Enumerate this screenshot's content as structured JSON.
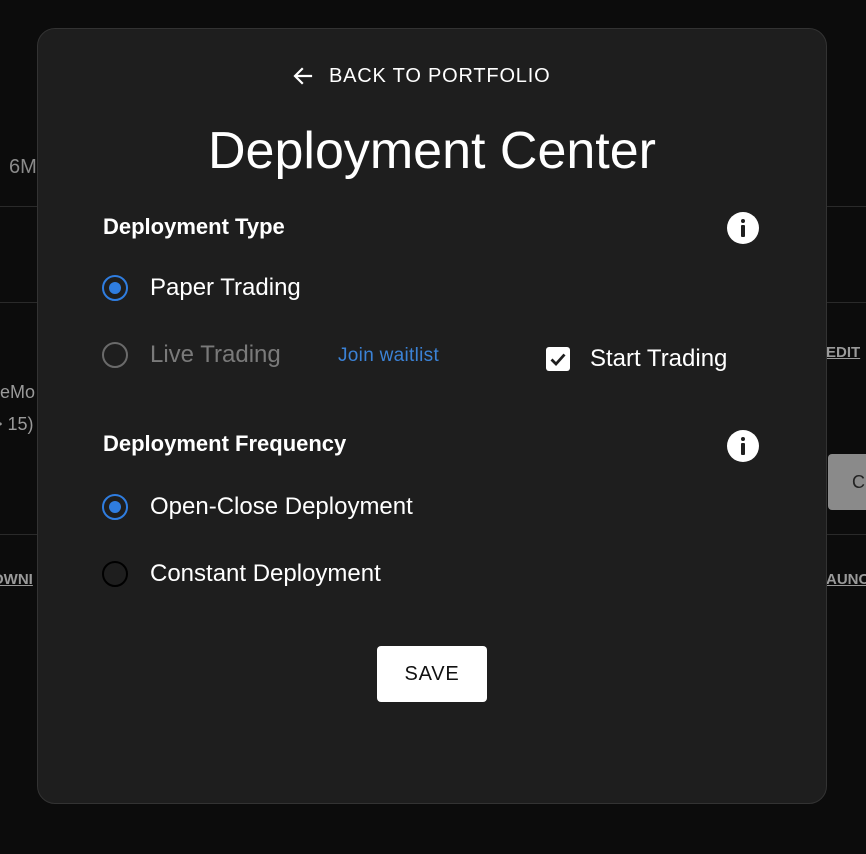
{
  "background": {
    "fragment_6m": "6M",
    "fragment_emo": "eMo",
    "fragment_15": "> 15)",
    "edit_link": "EDIT",
    "own_link": "OWNI",
    "aunc_link": "AUNC",
    "c_button": "C"
  },
  "modal": {
    "back_label": "BACK TO PORTFOLIO",
    "title": "Deployment Center",
    "deployment_type": {
      "title": "Deployment Type",
      "options": [
        {
          "label": "Paper Trading",
          "selected": true,
          "disabled": false
        },
        {
          "label": "Live Trading",
          "selected": false,
          "disabled": true
        }
      ],
      "waitlist_link": "Join waitlist",
      "start_trading": {
        "label": "Start Trading",
        "checked": true
      }
    },
    "deployment_frequency": {
      "title": "Deployment Frequency",
      "options": [
        {
          "label": "Open-Close Deployment",
          "selected": true
        },
        {
          "label": "Constant Deployment",
          "selected": false
        }
      ]
    },
    "save_label": "SAVE"
  },
  "icons": {
    "back": "arrow-left-icon",
    "info": "info-icon",
    "checkbox": "checkmark-icon"
  },
  "colors": {
    "accent": "#2f7de0",
    "link": "#3b82d6",
    "modal_bg": "#1e1e1e",
    "page_bg": "#0c0c0c"
  }
}
